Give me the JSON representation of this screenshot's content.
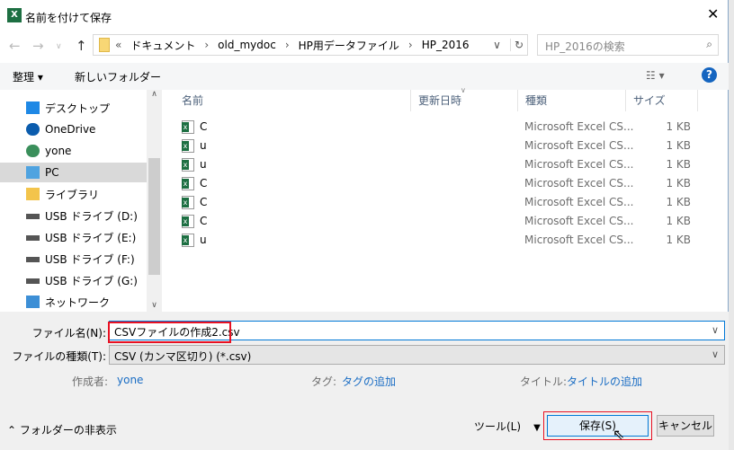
{
  "window": {
    "title": "名前を付けて保存",
    "app_icon": "excel-icon"
  },
  "address": {
    "prefix": "«",
    "path": [
      "ドキュメント",
      "old_mydoc",
      "HP用データファイル",
      "HP_2016"
    ],
    "search_placeholder": "HP_2016の検索"
  },
  "toolbar": {
    "organize": "整理 ▾",
    "new_folder": "新しいフォルダー",
    "help": "?"
  },
  "columns": [
    "名前",
    "更新日時",
    "種類",
    "サイズ"
  ],
  "nav_items": [
    {
      "label": "デスクトップ",
      "icon": "desktop-icon"
    },
    {
      "label": "OneDrive",
      "icon": "onedrive-icon"
    },
    {
      "label": "yone",
      "icon": "user-icon"
    },
    {
      "label": "PC",
      "icon": "pc-icon",
      "selected": true
    },
    {
      "label": "ライブラリ",
      "icon": "library-icon"
    },
    {
      "label": "USB ドライブ (D:)",
      "icon": "drive-icon"
    },
    {
      "label": "USB ドライブ (E:)",
      "icon": "drive-icon"
    },
    {
      "label": "USB ドライブ (F:)",
      "icon": "drive-icon"
    },
    {
      "label": "USB ドライブ (G:)",
      "icon": "drive-icon"
    },
    {
      "label": "ネットワーク",
      "icon": "network-icon"
    }
  ],
  "files": [
    {
      "name": "C",
      "type": "Microsoft Excel CS...",
      "size": "1 KB"
    },
    {
      "name": "u",
      "type": "Microsoft Excel CS...",
      "size": "1 KB"
    },
    {
      "name": "u",
      "type": "Microsoft Excel CS...",
      "size": "1 KB"
    },
    {
      "name": "C",
      "type": "Microsoft Excel CS...",
      "size": "1 KB"
    },
    {
      "name": "C",
      "type": "Microsoft Excel CS...",
      "size": "1 KB"
    },
    {
      "name": "C",
      "type": "Microsoft Excel CS...",
      "size": "1 KB"
    },
    {
      "name": "u",
      "type": "Microsoft Excel CS...",
      "size": "1 KB"
    }
  ],
  "form": {
    "filename_label": "ファイル名(N):",
    "filename_value": "CSVファイルの作成2.csv",
    "filetype_label": "ファイルの種類(T):",
    "filetype_value": "CSV (カンマ区切り) (*.csv)"
  },
  "meta": {
    "author_label": "作成者:",
    "author": "yone",
    "tag_label": "タグ:",
    "tag": "タグの追加",
    "title_label": "タイトル:",
    "title": "タイトルの追加"
  },
  "footer": {
    "hide_folders": "フォルダーの非表示",
    "tools": "ツール(L)",
    "save": "保存(S)",
    "cancel": "キャンセル"
  }
}
